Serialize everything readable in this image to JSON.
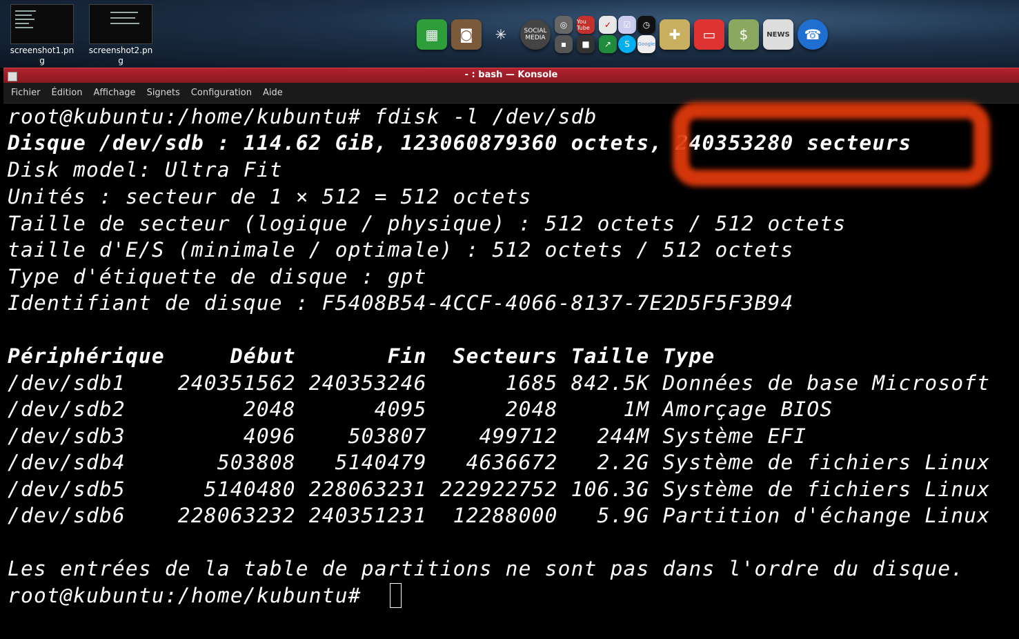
{
  "desktop": {
    "files": [
      {
        "label_line1": "screenshot1.pn",
        "label_line2": "g"
      },
      {
        "label_line1": "screenshot2.pn",
        "label_line2": "g"
      }
    ],
    "dock_icons": [
      "spreadsheet-icon",
      "radio-icon",
      "spiderweb-icon",
      "social-media-icon",
      "tape-recorder-icon",
      "youtube-icon",
      "cs-app-icon",
      "clock-icon",
      "skype-icon",
      "google-icon",
      "gamepad-icon",
      "usb-icon",
      "money-icon",
      "news-icon",
      "phone-icon"
    ],
    "dock_labels": {
      "social": "SOCIAL MEDIA",
      "youtube": "You Tube",
      "google": "Google",
      "news": "NEWS"
    }
  },
  "window": {
    "title": "- : bash — Konsole"
  },
  "menu": [
    "Fichier",
    "Édition",
    "Affichage",
    "Signets",
    "Configuration",
    "Aide"
  ],
  "terminal": {
    "lines": [
      {
        "text": "root@kubuntu:/home/kubuntu# fdisk -l /dev/sdb",
        "bold": false
      },
      {
        "text": "Disque /dev/sdb : 114.62 GiB, 123060879360 octets, 240353280 secteurs",
        "bold": true
      },
      {
        "text": "Disk model: Ultra Fit",
        "bold": false
      },
      {
        "text": "Unités : secteur de 1 × 512 = 512 octets",
        "bold": false
      },
      {
        "text": "Taille de secteur (logique / physique) : 512 octets / 512 octets",
        "bold": false
      },
      {
        "text": "taille d'E/S (minimale / optimale) : 512 octets / 512 octets",
        "bold": false
      },
      {
        "text": "Type d'étiquette de disque : gpt",
        "bold": false
      },
      {
        "text": "Identifiant de disque : F5408B54-4CCF-4066-8137-7E2D5F5F3B94",
        "bold": false
      },
      {
        "text": "",
        "bold": false
      },
      {
        "text": "Périphérique     Début       Fin  Secteurs Taille Type",
        "bold": true
      },
      {
        "text": "/dev/sdb1    240351562 240353246      1685 842.5K Données de base Microsoft",
        "bold": false
      },
      {
        "text": "/dev/sdb2         2048      4095      2048     1M Amorçage BIOS",
        "bold": false
      },
      {
        "text": "/dev/sdb3         4096    503807    499712   244M Système EFI",
        "bold": false
      },
      {
        "text": "/dev/sdb4       503808   5140479   4636672   2.2G Système de fichiers Linux",
        "bold": false
      },
      {
        "text": "/dev/sdb5      5140480 228063231 222922752 106.3G Système de fichiers Linux",
        "bold": false
      },
      {
        "text": "/dev/sdb6    228063232 240351231  12288000   5.9G Partition d'échange Linux",
        "bold": false
      },
      {
        "text": "",
        "bold": false
      },
      {
        "text": "Les entrées de la table de partitions ne sont pas dans l'ordre du disque.",
        "bold": false
      },
      {
        "text": "root@kubuntu:/home/kubuntu# ",
        "bold": false
      }
    ],
    "highlight_color": "#e0390c"
  }
}
